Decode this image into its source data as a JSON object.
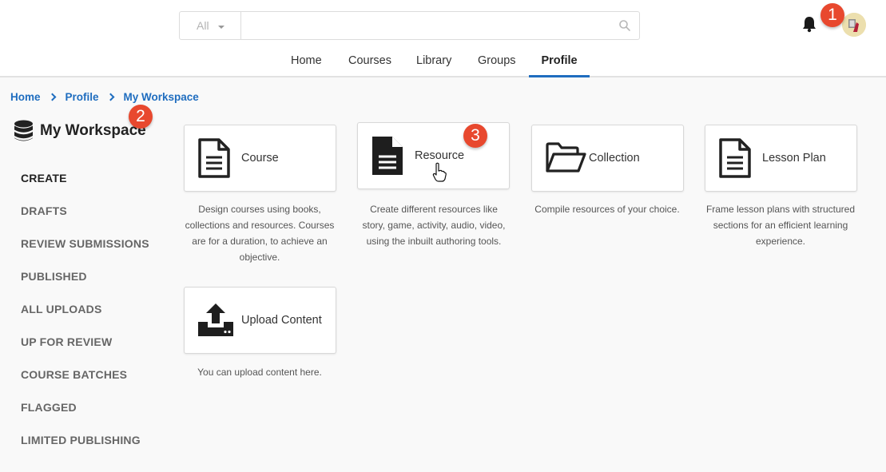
{
  "header": {
    "search": {
      "filter_label": "All",
      "value": "",
      "placeholder": ""
    },
    "nav": [
      {
        "label": "Home"
      },
      {
        "label": "Courses"
      },
      {
        "label": "Library"
      },
      {
        "label": "Groups"
      },
      {
        "label": "Profile",
        "active": true
      }
    ]
  },
  "badges": [
    "1",
    "2",
    "3"
  ],
  "breadcrumb": [
    "Home",
    "Profile",
    "My Workspace"
  ],
  "sidebar": {
    "title": "My Workspace",
    "items": [
      {
        "label": "CREATE",
        "active": true
      },
      {
        "label": "DRAFTS"
      },
      {
        "label": "REVIEW SUBMISSIONS"
      },
      {
        "label": "PUBLISHED"
      },
      {
        "label": "ALL UPLOADS"
      },
      {
        "label": "UP FOR REVIEW"
      },
      {
        "label": "COURSE BATCHES"
      },
      {
        "label": "FLAGGED"
      },
      {
        "label": "LIMITED PUBLISHING"
      }
    ]
  },
  "cards": [
    {
      "label": "Course",
      "icon": "document-outline-icon",
      "description": [
        "Design courses using books,",
        "collections and resources. Courses",
        "are for a duration, to achieve an",
        "objective."
      ]
    },
    {
      "label": "Resource",
      "icon": "document-filled-icon",
      "description": [
        "Create different resources like",
        "story, game, activity, audio, video,",
        "using the inbuilt authoring tools."
      ]
    },
    {
      "label": "Collection",
      "icon": "folder-open-icon",
      "description": [
        "Compile resources of your choice."
      ]
    },
    {
      "label": "Lesson Plan",
      "icon": "document-outline-icon",
      "description": [
        "Frame lesson plans with structured",
        "sections for an efficient learning",
        "experience."
      ]
    },
    {
      "label": "Upload Content",
      "icon": "upload-icon",
      "description": [
        "You can upload content here."
      ]
    }
  ],
  "colors": {
    "accent": "#1f6dbf",
    "badge": "#e8482e"
  }
}
